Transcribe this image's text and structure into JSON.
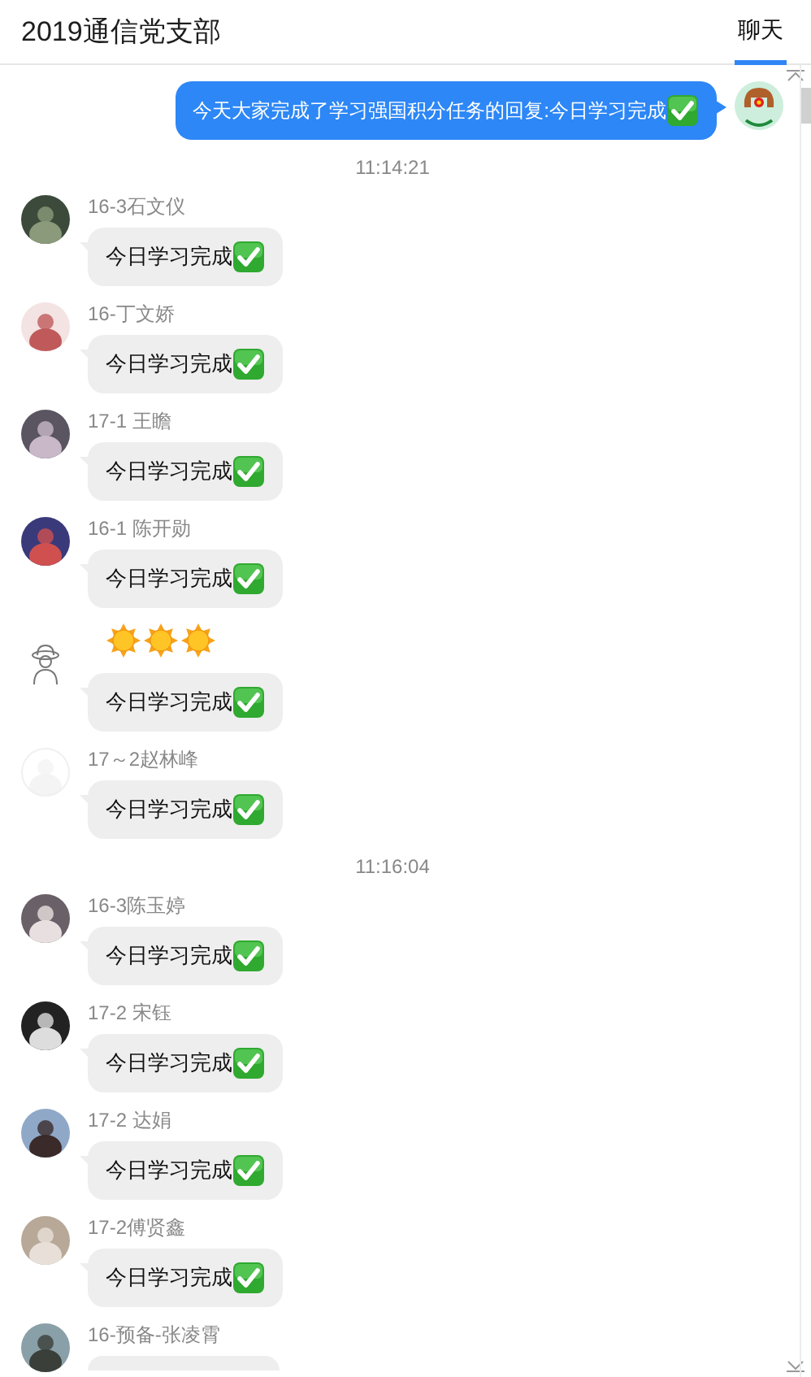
{
  "header": {
    "title": "2019通信党支部",
    "tabs": [
      {
        "label": "聊天",
        "selected": true
      }
    ]
  },
  "messages": [
    {
      "kind": "outgoing",
      "text": "今天大家完成了学习强国积分任务的回复:今日学习完成"
    },
    {
      "kind": "time",
      "text": "11:14:21"
    },
    {
      "kind": "group",
      "sender": "16-3石文仪",
      "bubbles": [
        {
          "kind": "text",
          "text": "今日学习完成"
        }
      ]
    },
    {
      "kind": "group",
      "sender": "16-丁文娇",
      "bubbles": [
        {
          "kind": "text",
          "text": "今日学习完成"
        }
      ]
    },
    {
      "kind": "group",
      "sender": "17-1 王瞻",
      "bubbles": [
        {
          "kind": "text",
          "text": "今日学习完成"
        }
      ]
    },
    {
      "kind": "group",
      "sender": "16-1 陈开勋",
      "bubbles": [
        {
          "kind": "text",
          "text": "今日学习完成"
        }
      ]
    },
    {
      "kind": "group",
      "bubbles": [
        {
          "kind": "suns"
        },
        {
          "kind": "text",
          "text": "今日学习完成"
        }
      ]
    },
    {
      "kind": "group",
      "sender": "17～2赵林峰",
      "bubbles": [
        {
          "kind": "text",
          "text": "今日学习完成"
        }
      ]
    },
    {
      "kind": "time",
      "text": "11:16:04"
    },
    {
      "kind": "group",
      "sender": "16-3陈玉婷",
      "bubbles": [
        {
          "kind": "text",
          "text": "今日学习完成"
        }
      ]
    },
    {
      "kind": "group",
      "sender": "17-2 宋钰",
      "bubbles": [
        {
          "kind": "text",
          "text": "今日学习完成"
        }
      ]
    },
    {
      "kind": "group",
      "sender": "17-2 达娟",
      "bubbles": [
        {
          "kind": "text",
          "text": "今日学习完成"
        }
      ]
    },
    {
      "kind": "group",
      "sender": "17-2傅贤鑫",
      "bubbles": [
        {
          "kind": "text",
          "text": "今日学习完成"
        }
      ]
    },
    {
      "kind": "group",
      "sender": "16-预备-张凌霄",
      "bubbles": [
        {
          "kind": "partial"
        }
      ]
    }
  ]
}
